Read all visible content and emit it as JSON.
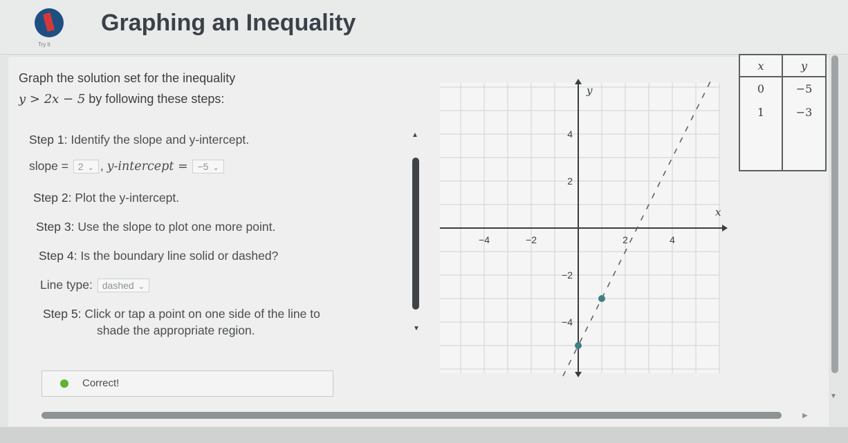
{
  "header": {
    "title": "Graphing an Inequality",
    "logo_caption": "Try It"
  },
  "prompt": {
    "line1": "Graph the solution set for the inequality",
    "inequality": "y > 2x − 5",
    "line2_suffix": " by following these steps:"
  },
  "steps": {
    "step1": {
      "label": "Step 1:",
      "text": " Identify the slope and y-intercept."
    },
    "slope": {
      "label": "slope =",
      "value": "2",
      "sep": ",",
      "yint_label": "y-intercept =",
      "yint_value": "−5"
    },
    "step2": {
      "label": "Step 2:",
      "text": " Plot the y-intercept."
    },
    "step3": {
      "label": "Step 3:",
      "text": " Use the slope to plot one more point."
    },
    "step4": {
      "label": "Step 4:",
      "text": " Is the boundary line solid or dashed?"
    },
    "linetype": {
      "label": "Line type:",
      "value": "dashed"
    },
    "step5": {
      "label": "Step 5:",
      "text": " Click or tap a point on one side of the line to",
      "text2": "shade the appropriate region."
    }
  },
  "status": {
    "text": "Correct!",
    "color": "#5cb531"
  },
  "chart_data": {
    "type": "scatter",
    "xlabel": "x",
    "ylabel": "y",
    "xlim": [
      -6,
      6
    ],
    "ylim": [
      -6,
      6
    ],
    "x_ticks": [
      "−4",
      "−2",
      "2",
      "4"
    ],
    "y_ticks": [
      "4",
      "2",
      "−2",
      "−4"
    ],
    "grid": true,
    "points": [
      {
        "x": 0,
        "y": -5
      },
      {
        "x": 1,
        "y": -3
      }
    ],
    "boundary_line": {
      "slope": 2,
      "intercept": -5,
      "style": "dashed"
    },
    "point_color": "#3f7f86"
  },
  "table": {
    "headers": [
      "x",
      "y"
    ],
    "rows": [
      [
        "0",
        "−5"
      ],
      [
        "1",
        "−3"
      ],
      [
        "",
        ""
      ],
      [
        "",
        ""
      ]
    ]
  }
}
